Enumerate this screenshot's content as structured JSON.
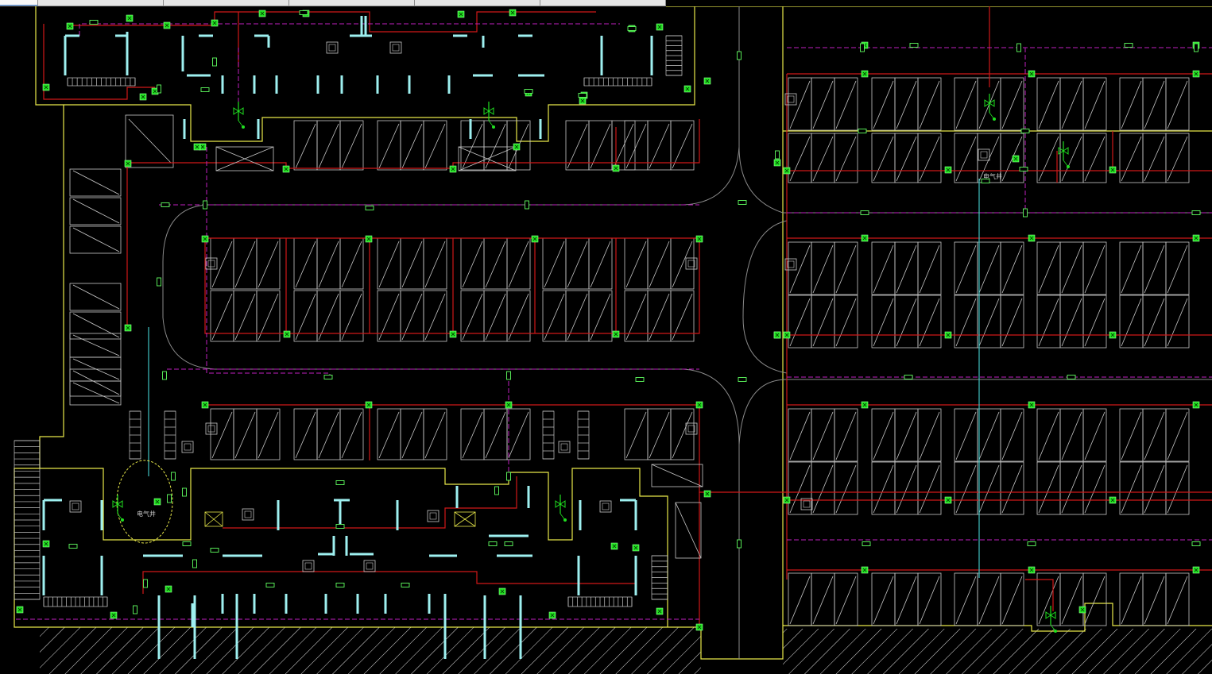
{
  "tabs": [
    {
      "label": ""
    },
    {
      "label": ""
    },
    {
      "label": ""
    },
    {
      "label": ""
    },
    {
      "label": ""
    },
    {
      "label": ""
    }
  ],
  "labels": {
    "well_label_top": "电气井",
    "well_label_bottom": "电气井"
  },
  "colors": {
    "background": "#000000",
    "wall": "#e8e84a",
    "column": "#9ef0f0",
    "parking": "#d0d0d0",
    "power_line": "#d01818",
    "signal_line": "#c020c0",
    "device": "#20e020",
    "trunk": "#40c0c0"
  },
  "icons": [
    "fire-alarm-detector-icon",
    "manual-call-point-icon",
    "junction-box-icon",
    "riser-symbol-icon"
  ]
}
